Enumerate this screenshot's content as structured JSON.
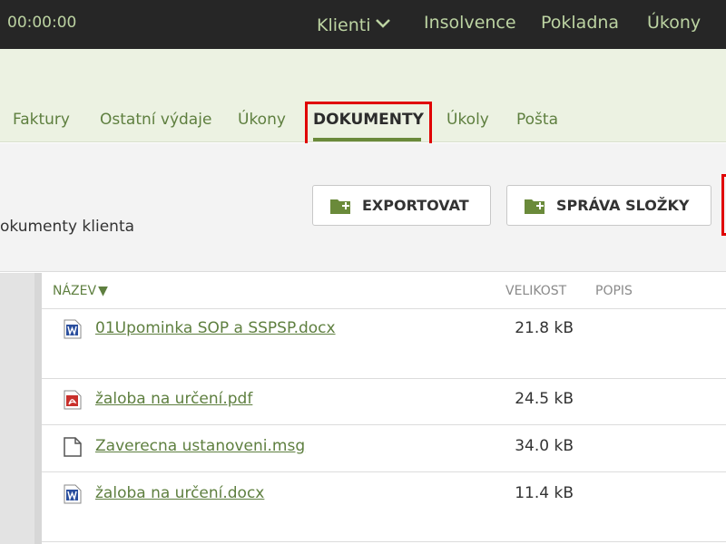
{
  "topbar": {
    "timer": "00:00:00",
    "nav": [
      {
        "label": "Klienti",
        "has_dropdown": true
      },
      {
        "label": "Insolvence"
      },
      {
        "label": "Pokladna"
      },
      {
        "label": "Úkony"
      }
    ]
  },
  "tabs": [
    {
      "label": "Faktury",
      "active": false
    },
    {
      "label": "Ostatní výdaje",
      "active": false
    },
    {
      "label": "Úkony",
      "active": false
    },
    {
      "label": "DOKUMENTY",
      "active": true
    },
    {
      "label": "Úkoly",
      "active": false
    },
    {
      "label": "Pošta",
      "active": false
    }
  ],
  "toolbar": {
    "subtitle": "okumenty klienta",
    "export_label": "EXPORTOVAT",
    "manage_folder_label": "SPRÁVA SLOŽKY"
  },
  "table": {
    "headers": {
      "name": "NÁZEV",
      "size": "VELIKOST",
      "description": "POPIS"
    },
    "rows": [
      {
        "name": "01Upominka SOP a SSPSP.docx",
        "size": "21.8 kB",
        "icon": "word-icon"
      },
      {
        "name": "žaloba na určení.pdf",
        "size": "24.5 kB",
        "icon": "pdf-icon"
      },
      {
        "name": "Zaverecna ustanoveni.msg",
        "size": "34.0 kB",
        "icon": "file-icon"
      },
      {
        "name": "žaloba na určení.docx",
        "size": "11.4 kB",
        "icon": "word-icon"
      }
    ]
  },
  "colors": {
    "topbar_bg": "#262626",
    "accent_green": "#5e7f3f",
    "highlight_red": "#e00000"
  }
}
